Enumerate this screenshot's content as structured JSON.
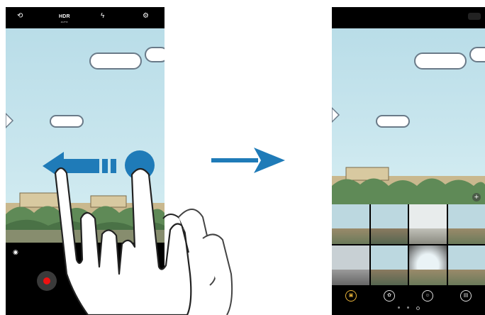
{
  "left_phone": {
    "top_bar": {
      "camera_switch_icon": "switch-camera-icon",
      "hdr_label": "HDR",
      "hdr_sub_label": "AUTO",
      "flash_icon": "flash-off-icon",
      "settings_icon": "gear-icon"
    },
    "bottom_bar": {
      "eye_icon": "eye-icon",
      "record_button_icon": "record-icon"
    }
  },
  "right_phone": {
    "top_bar": {
      "indicator_icon": "status-pill"
    },
    "add_button_label": "+",
    "filter_tiles": [
      {
        "style": "normal"
      },
      {
        "style": "normal"
      },
      {
        "style": "normal"
      },
      {
        "style": "normal"
      },
      {
        "style": "warm"
      },
      {
        "style": "normal"
      },
      {
        "style": "vignette"
      },
      {
        "style": "normal"
      }
    ],
    "mode_buttons": [
      {
        "icon": "filter-icon",
        "active": true
      },
      {
        "icon": "beauty-icon",
        "active": false
      },
      {
        "icon": "person-icon",
        "active": false
      },
      {
        "icon": "frame-icon",
        "active": false
      }
    ],
    "page_indicator": {
      "total": 3,
      "current": 2
    }
  },
  "transition": {
    "arrow_icon": "right-arrow-icon"
  },
  "gesture": {
    "hand_icon": "two-finger-swipe-hand-icon",
    "swipe_arrow_icon": "left-arrow-icon"
  },
  "colors": {
    "arrow_blue": "#1f7bb8",
    "active_mode": "#e9b33a",
    "record_red": "#e11111"
  }
}
